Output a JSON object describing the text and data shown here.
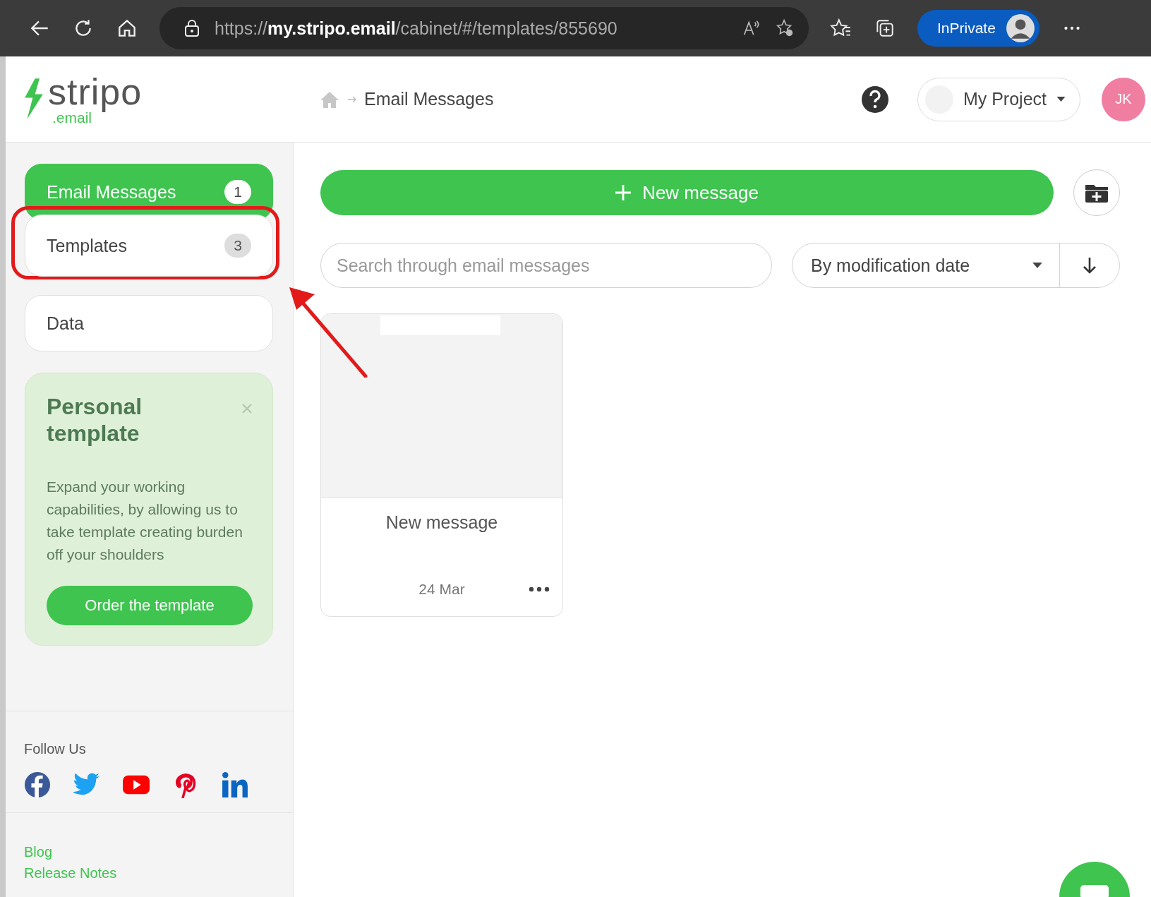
{
  "browser": {
    "url_scheme": "https://",
    "url_host": "my.stripo.email",
    "url_path": "/cabinet/#/templates/855690",
    "profile_label": "InPrivate"
  },
  "header": {
    "logo_name": "stripo",
    "logo_sub": ".email",
    "breadcrumb": "Email Messages",
    "project": "My Project",
    "avatar": "JK"
  },
  "sidebar": {
    "nav": [
      {
        "label": "Email Messages",
        "count": "1",
        "selected": true
      },
      {
        "label": "Templates",
        "count": "3",
        "selected": false
      },
      {
        "label": "Data",
        "selected": false
      }
    ],
    "promo": {
      "title": "Personal template",
      "text": "Expand your working capabilities, by allowing us to take template creating burden off your shoulders",
      "button": "Order the template"
    },
    "follow_label": "Follow Us",
    "social": [
      {
        "kind": "facebook"
      },
      {
        "kind": "twitter"
      },
      {
        "kind": "youtube"
      },
      {
        "kind": "pinterest"
      },
      {
        "kind": "linkedin"
      }
    ],
    "links": [
      "Blog",
      "Release Notes"
    ]
  },
  "main": {
    "new_button": "New message",
    "search": {
      "placeholder": "Search through email messages"
    },
    "sort": "By modification date",
    "cards": [
      {
        "title": "New message",
        "date": "24 Mar"
      }
    ]
  },
  "annotations": {
    "highlight_outline": true,
    "pointer_arrow": true
  }
}
